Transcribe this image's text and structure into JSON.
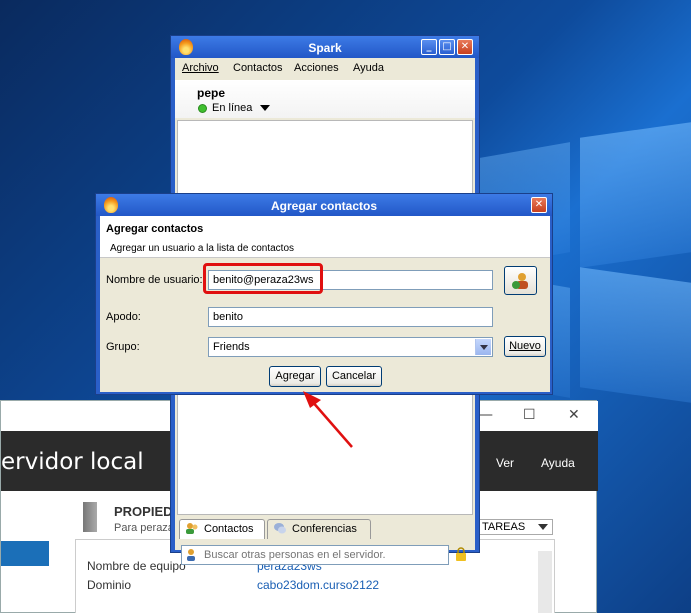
{
  "server_manager": {
    "title": "ervidor local",
    "menu": {
      "view": "Ver",
      "help": "Ayuda"
    },
    "window_controls": {
      "minimize": "—",
      "maximize": "☐",
      "close": "✕"
    },
    "properties": {
      "title": "PROPIED",
      "subtitle": "Para peraza",
      "tasks_label": "TAREAS",
      "rows": [
        {
          "label": "Nombre de equipo",
          "value": "peraza23ws"
        },
        {
          "label": "Dominio",
          "value": "cabo23dom.curso2122"
        }
      ]
    }
  },
  "spark": {
    "title": "Spark",
    "menu": [
      "Archivo",
      "Contactos",
      "Acciones",
      "Ayuda"
    ],
    "user": {
      "name": "pepe",
      "status": "En línea"
    },
    "tabs": [
      "Contactos",
      "Conferencias"
    ],
    "search": {
      "placeholder": "Buscar otras personas en el servidor."
    },
    "colors": {
      "status_online": "#3fbf2f",
      "titlebar": "#2257c7"
    }
  },
  "dialog": {
    "title": "Agregar contactos",
    "heading": "Agregar contactos",
    "description": "Agregar un usuario a la lista de contactos",
    "fields": {
      "username": {
        "label": "Nombre de usuario:",
        "value": "benito@peraza23ws"
      },
      "nickname": {
        "label": "Apodo:",
        "value": "benito"
      },
      "group": {
        "label": "Grupo:",
        "value": "Friends"
      }
    },
    "buttons": {
      "new": "Nuevo",
      "add": "Agregar",
      "cancel": "Cancelar"
    },
    "highlight_color": "#e01010"
  }
}
